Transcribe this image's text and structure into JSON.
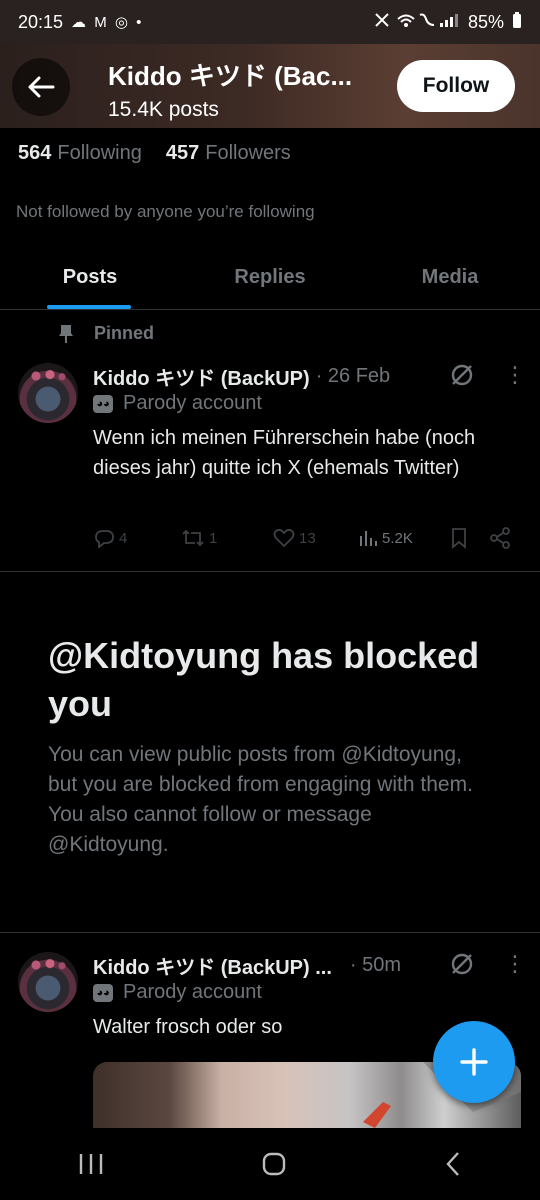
{
  "status_bar": {
    "time": "20:15",
    "left_icons": "☁ M ◎ •",
    "battery": "85%"
  },
  "header": {
    "title": "Kiddo キツド (Bac...",
    "posts_count": "15.4K posts",
    "follow_label": "Follow"
  },
  "profile": {
    "following_count": "564",
    "following_label": "Following",
    "followers_count": "457",
    "followers_label": "Followers",
    "not_followed": "Not followed by anyone you’re following"
  },
  "tabs": [
    {
      "label": "Posts"
    },
    {
      "label": "Replies"
    },
    {
      "label": "Media"
    }
  ],
  "pinned_post": {
    "pinned_label": "Pinned",
    "name": "Kiddo キツド (BackUP)",
    "time": "· 26 Feb",
    "parody": "Parody account",
    "text": "Wenn ich meinen Führerschein habe (noch dieses jahr) quitte ich X (ehemals Twitter)",
    "replies": "4",
    "reposts": "1",
    "likes": "13",
    "views": "5.2K"
  },
  "blocked": {
    "title": "@Kidtoyung has blocked you",
    "description": "You can view public posts from @Kidtoyung, but you are blocked from engaging with them. You also cannot follow or message @Kidtoyung."
  },
  "second_post": {
    "name": "Kiddo キツド (BackUP) ...",
    "time": "· 50m",
    "parody": "Parody account",
    "text": "Walter frosch oder so"
  },
  "colors": {
    "accent": "#1d9bf0",
    "background": "#000000",
    "muted": "#71767b"
  }
}
